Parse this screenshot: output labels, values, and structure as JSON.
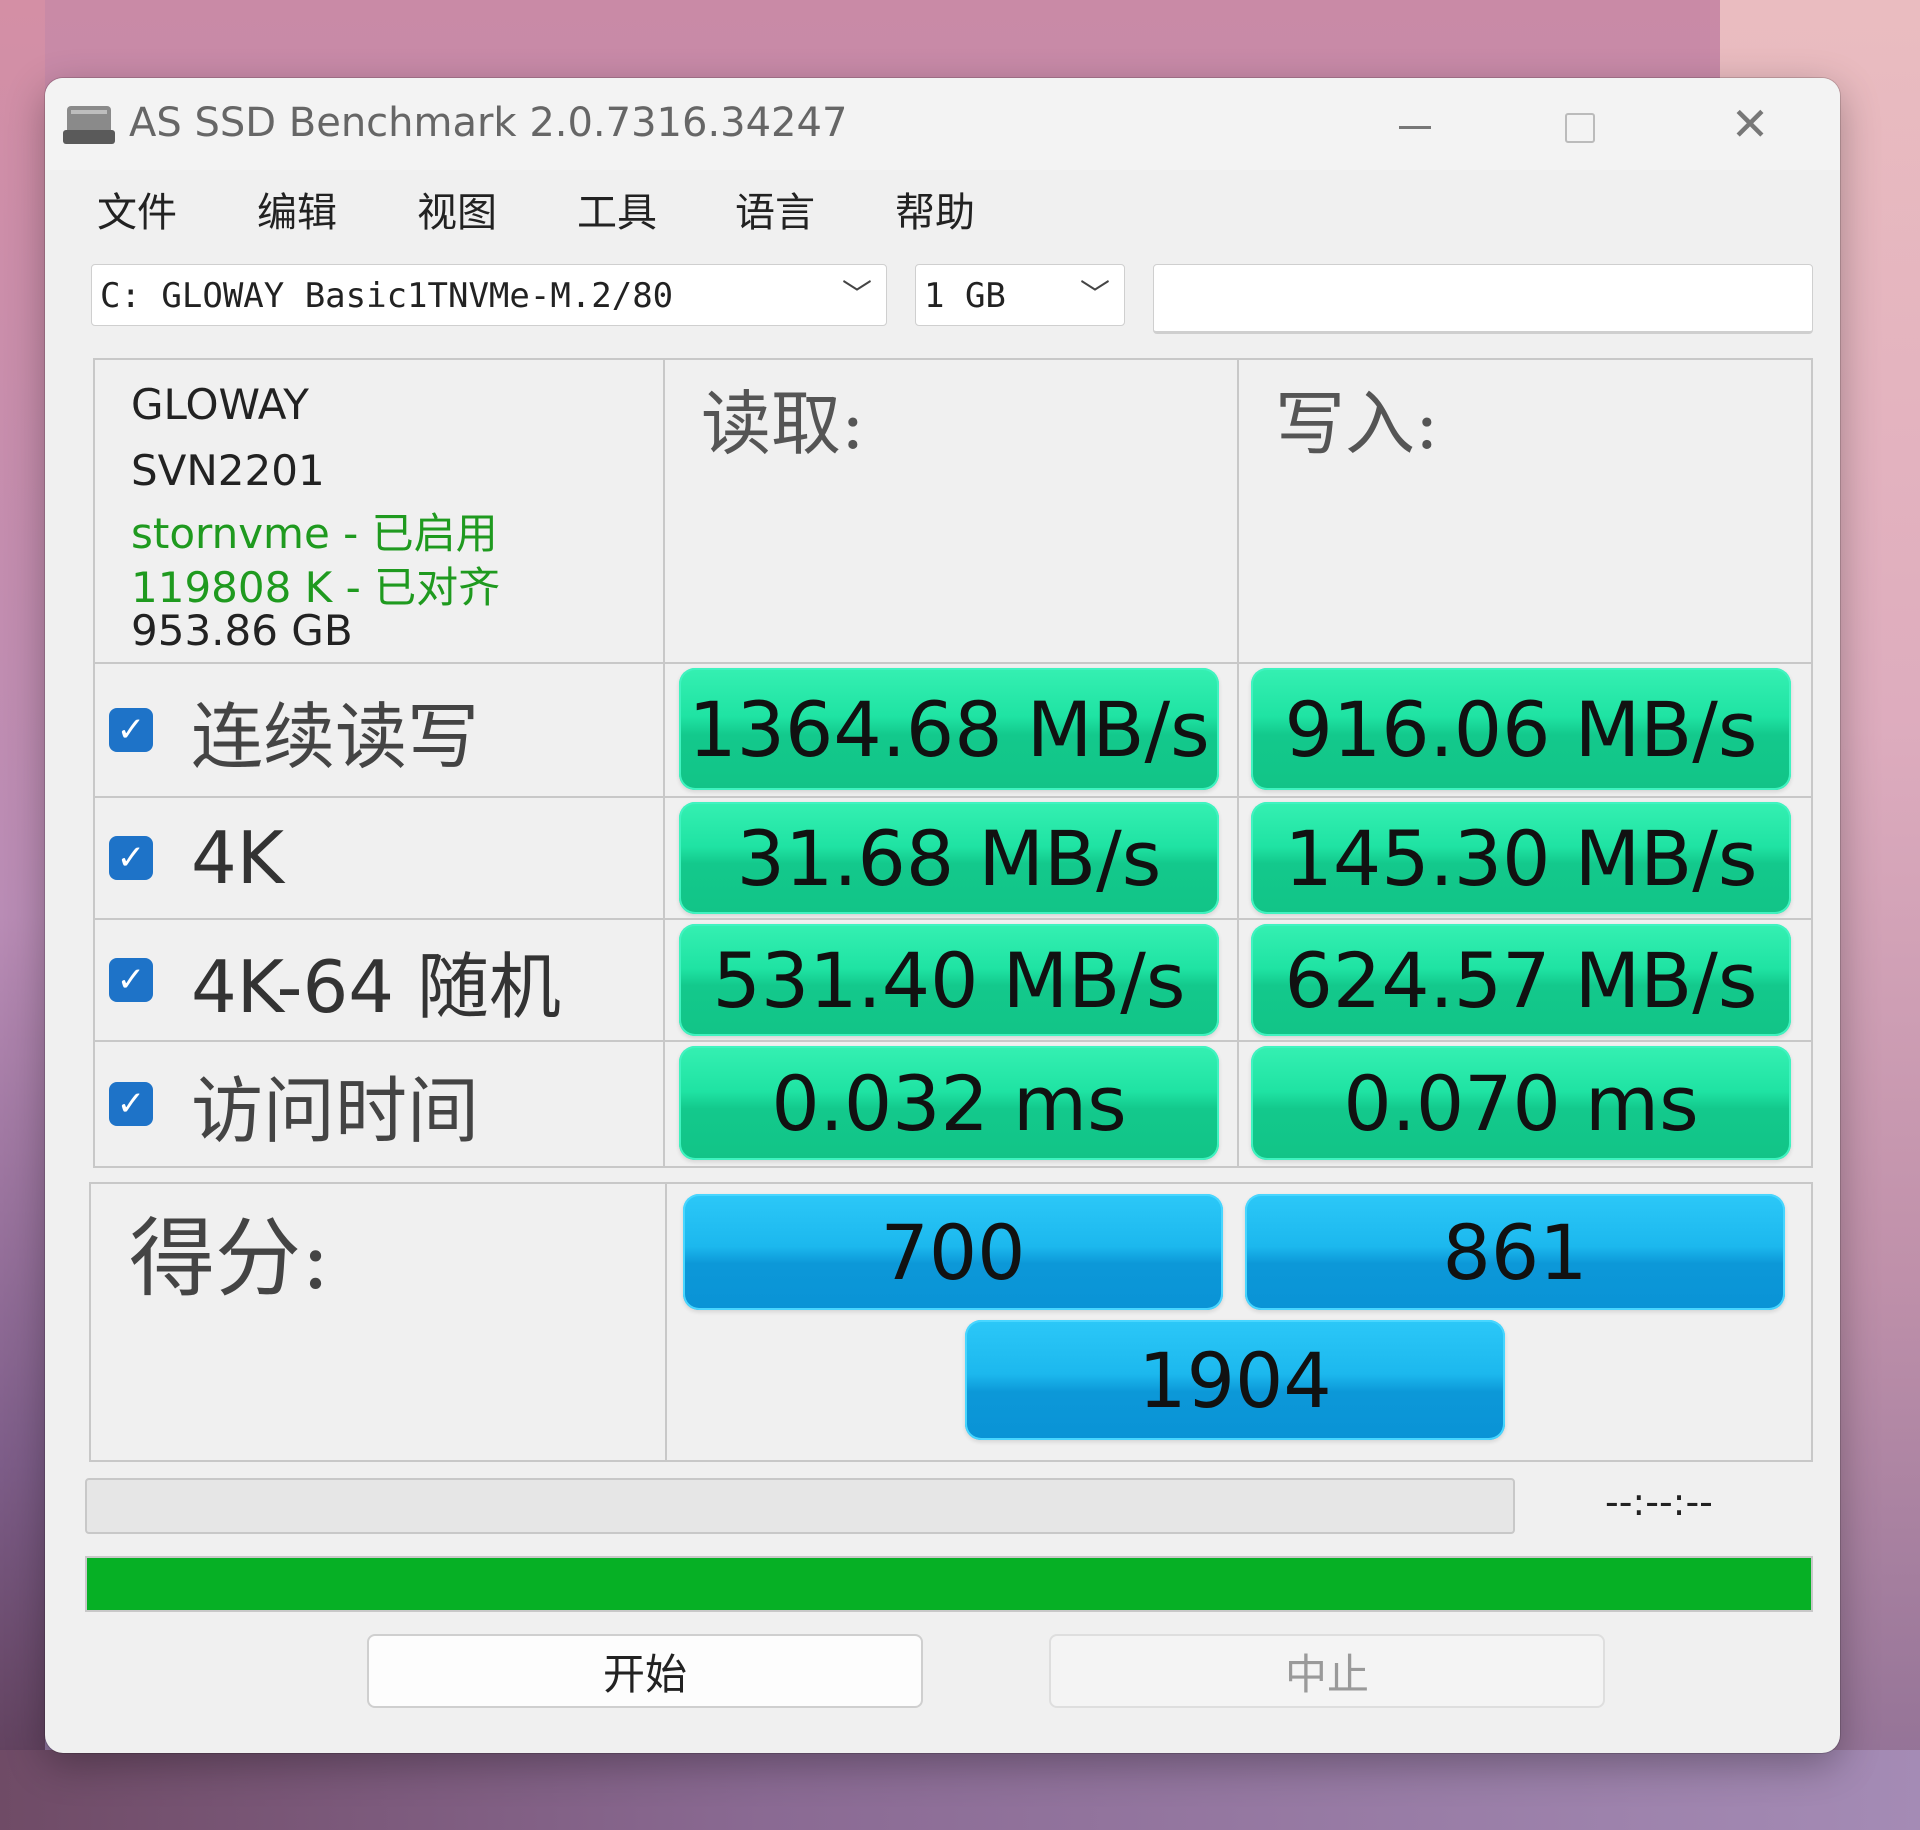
{
  "window": {
    "title": "AS SSD Benchmark 2.0.7316.34247",
    "controls": {
      "minimize": "minimize",
      "maximize": "maximize",
      "close": "✕"
    }
  },
  "menu": [
    "文件",
    "编辑",
    "视图",
    "工具",
    "语言",
    "帮助"
  ],
  "toolbar": {
    "drive_select": "C:  GLOWAY Basic1TNVMe-M.2/80",
    "size_select": "1  GB"
  },
  "device": {
    "vendor": "GLOWAY",
    "firmware": "SVN2201",
    "driver": "stornvme - 已启用",
    "alignment": "119808 K - 已对齐",
    "capacity": "953.86 GB"
  },
  "headers": {
    "read": "读取:",
    "write": "写入:"
  },
  "rows": [
    {
      "label": "连续读写",
      "checked": true,
      "read": "1364.68 MB/s",
      "write": "916.06 MB/s"
    },
    {
      "label": "4K",
      "checked": true,
      "read": "31.68 MB/s",
      "write": "145.30 MB/s"
    },
    {
      "label": "4K-64 随机",
      "checked": true,
      "read": "531.40 MB/s",
      "write": "624.57 MB/s"
    },
    {
      "label": "访问时间",
      "checked": true,
      "read": "0.032 ms",
      "write": "0.070 ms"
    }
  ],
  "score": {
    "label": "得分:",
    "read": "700",
    "write": "861",
    "total": "1904"
  },
  "status": {
    "timer": "--:--:--",
    "progress_fraction": 1.0
  },
  "buttons": {
    "start": "开始",
    "abort": "中止"
  },
  "colors": {
    "result_green": "#1fe3a3",
    "score_blue": "#1cb8ee",
    "progress_green": "#06b025",
    "info_green": "#1f9a1f"
  },
  "icons": {
    "app": "drive-icon",
    "check": "checkbox-checked-icon",
    "dropdown": "chevron-down-icon"
  }
}
